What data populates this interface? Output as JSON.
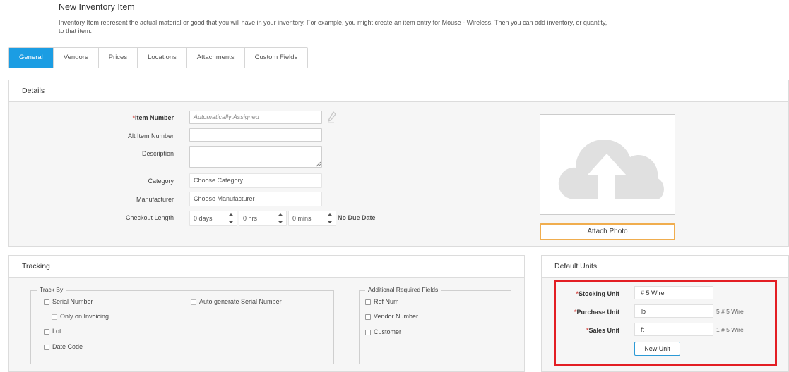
{
  "header": {
    "title": "New Inventory Item",
    "description": "Inventory Item represent the actual material or good that you will have in your inventory. For example, you might create an item entry for Mouse - Wireless. Then you can add inventory, or quantity, to that item."
  },
  "tabs": [
    {
      "label": "General",
      "active": true
    },
    {
      "label": "Vendors"
    },
    {
      "label": "Prices"
    },
    {
      "label": "Locations"
    },
    {
      "label": "Attachments"
    },
    {
      "label": "Custom Fields"
    }
  ],
  "details": {
    "title": "Details",
    "item_number": {
      "label": "Item Number",
      "placeholder": "Automatically Assigned"
    },
    "alt_item_number": {
      "label": "Alt Item Number",
      "value": ""
    },
    "description": {
      "label": "Description",
      "value": ""
    },
    "category": {
      "label": "Category",
      "value": "Choose Category"
    },
    "manufacturer": {
      "label": "Manufacturer",
      "value": "Choose Manufacturer"
    },
    "checkout_length": {
      "label": "Checkout Length",
      "days": "0 days",
      "hrs": "0 hrs",
      "mins": "0 mins",
      "note": "No Due Date"
    },
    "attach_photo_label": "Attach Photo"
  },
  "tracking": {
    "title": "Tracking",
    "track_by": {
      "legend": "Track By",
      "serial_number": "Serial Number",
      "only_on_invoicing": "Only on Invoicing",
      "lot": "Lot",
      "date_code": "Date Code",
      "auto_serial": "Auto generate Serial Number"
    },
    "additional": {
      "legend": "Additional Required Fields",
      "ref_num": "Ref Num",
      "vendor_number": "Vendor Number",
      "customer": "Customer"
    }
  },
  "default_units": {
    "title": "Default Units",
    "stocking": {
      "label": "Stocking Unit",
      "value": "# 5 Wire",
      "conversion": ""
    },
    "purchase": {
      "label": "Purchase Unit",
      "value": "lb",
      "conversion": "5 # 5 Wire"
    },
    "sales": {
      "label": "Sales Unit",
      "value": "ft",
      "conversion": "1 # 5 Wire"
    },
    "new_unit_label": "New Unit"
  },
  "colors": {
    "accent": "#1b9de3",
    "highlight": "#e31e24",
    "attach_border": "#f0ad4e",
    "required": "#d9534f"
  }
}
